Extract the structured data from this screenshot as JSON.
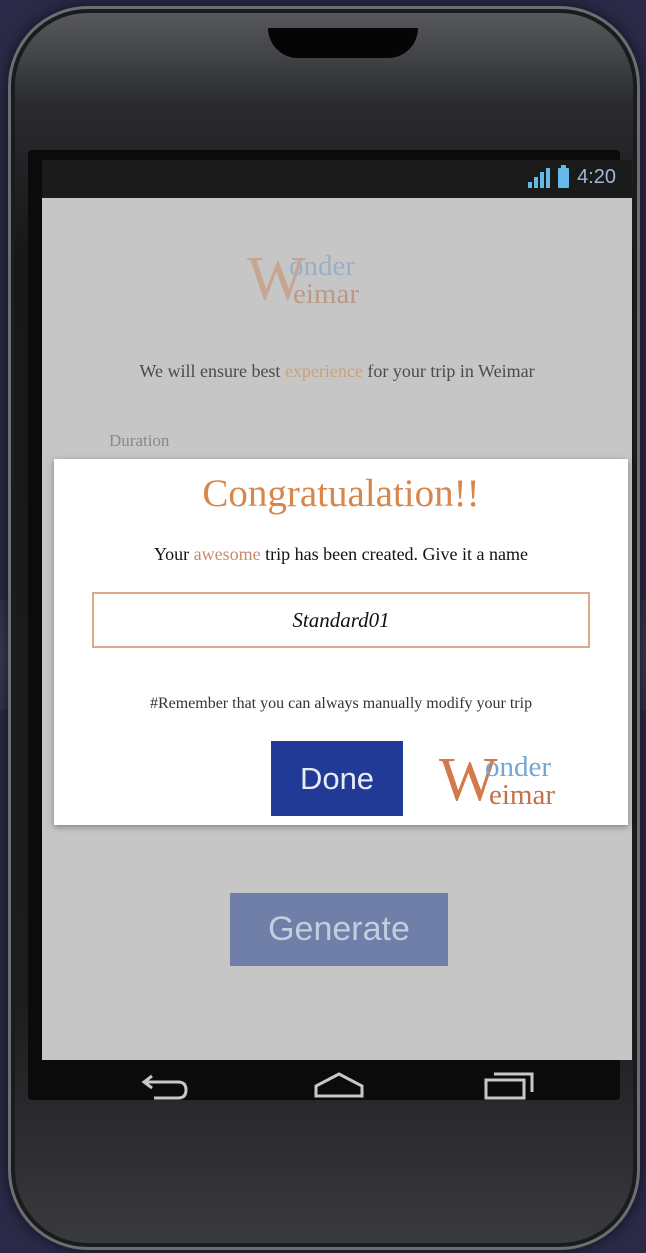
{
  "status_bar": {
    "time": "4:20",
    "signal_icon": "signal-icon",
    "battery_icon": "battery-icon"
  },
  "background": {
    "logo": {
      "w": "W",
      "onder": "onder",
      "eimar": "eimar"
    },
    "tagline_before": "We will ensure best ",
    "tagline_accent": "experience",
    "tagline_after": " for your trip in Weimar",
    "duration_label": "Duration",
    "generate_label": "Generate"
  },
  "dialog": {
    "title": "Congratualation!!",
    "message_before": "Your ",
    "message_accent": "awesome",
    "message_after": " trip has been created. Give it a name",
    "name_value": "Standard01",
    "remember_text": "#Remember that you can always manually modify your trip",
    "done_label": "Done",
    "logo": {
      "w": "W",
      "onder": "onder",
      "eimar": "eimar"
    }
  },
  "nav_bar": {
    "back_icon": "back-icon",
    "home_icon": "home-icon",
    "recents_icon": "recents-icon"
  },
  "colors": {
    "accent_orange": "#d9864a",
    "done_blue": "#213a96",
    "generate_blue": "#6f7fa8",
    "logo_blue": "#6fa7d8"
  }
}
